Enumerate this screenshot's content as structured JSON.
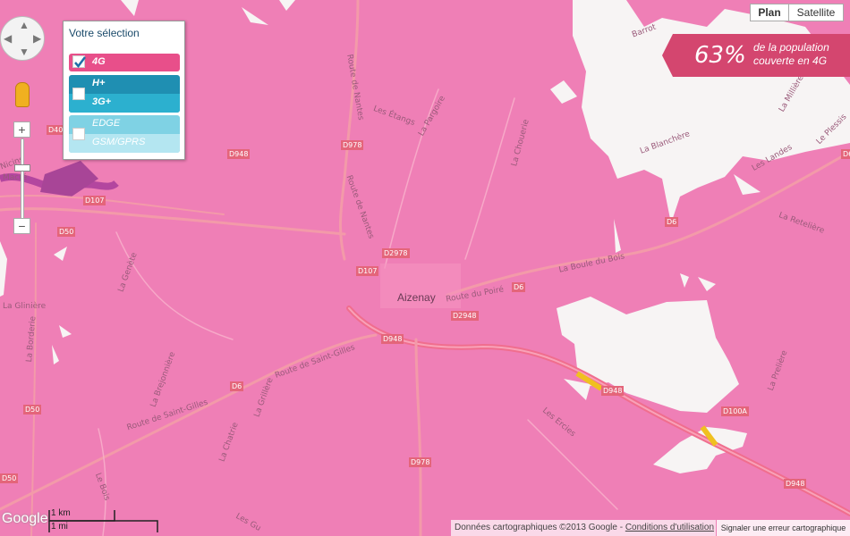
{
  "selection": {
    "title": "Votre sélection",
    "options": [
      {
        "label": "4G",
        "checked": true
      },
      {
        "label": "H+",
        "sub": "3G+",
        "checked": false
      },
      {
        "label": "EDGE",
        "sub": "GSM/GPRS",
        "checked": false
      }
    ]
  },
  "map_type": {
    "plan": "Plan",
    "satellite": "Satellite",
    "active": "Plan"
  },
  "coverage": {
    "percent": "63%",
    "line1": "de la population",
    "line2": "couverte en 4G"
  },
  "zoom": {
    "in": "+",
    "out": "−"
  },
  "scale": {
    "km": "1 km",
    "mi": "1 mi"
  },
  "logo": "Google",
  "attribution": {
    "data": "Données cartographiques ©2013 Google -",
    "terms": "Conditions d'utilisation",
    "report": "Signaler une erreur cartographique"
  },
  "town": "Aizenay",
  "roads": {
    "d978_a": "D978",
    "d978_b": "D978",
    "d948_a": "D948",
    "d948_b": "D948",
    "d948_c": "D948",
    "d948_d": "D948",
    "d107_a": "D107",
    "d107_b": "D107",
    "d50_a": "D50",
    "d50_b": "D50",
    "d40": "D40",
    "d2978": "D2978",
    "d2948": "D2948",
    "d6_a": "D6",
    "d6_b": "D6",
    "d6_c": "D6",
    "d100a": "D100A",
    "d6_d": "D6",
    "d50_c": "D50"
  },
  "places": {
    "route_nantes_a": "Route de Nantes",
    "route_nantes_b": "Route de Nantes",
    "les_etangs": "Les Étangs",
    "la_pargoire": "La Pargoire",
    "la_chouerie": "La Chouerie",
    "barrot": "Barrot",
    "la_milliere": "La Millière",
    "la_blanchere": "La Blanchère",
    "les_landes": "Les Landes",
    "le_plessis": "Le Plessis",
    "la_retellere": "La Retelière",
    "la_boule_du_bois": "La Boule du Bois",
    "route_du_poire": "Route du Poiré",
    "la_genete": "La Genète",
    "la_gliniere": "La Glinière",
    "la_borderie": "La Borderie",
    "la_brejonniere": "La Brejonnière",
    "route_saint_gilles_a": "Route de Saint-Gilles",
    "route_saint_gilles_b": "Route de Saint-Gilles",
    "la_grillere": "La Grillère",
    "la_chatrie": "La Chatrie",
    "les_ercies": "Les Ercies",
    "la_preliere": "La Prelière",
    "le_bois": "Le Bois",
    "macre": "Macré",
    "nicins": "Nicins",
    "les_gu": "Les Gu"
  }
}
